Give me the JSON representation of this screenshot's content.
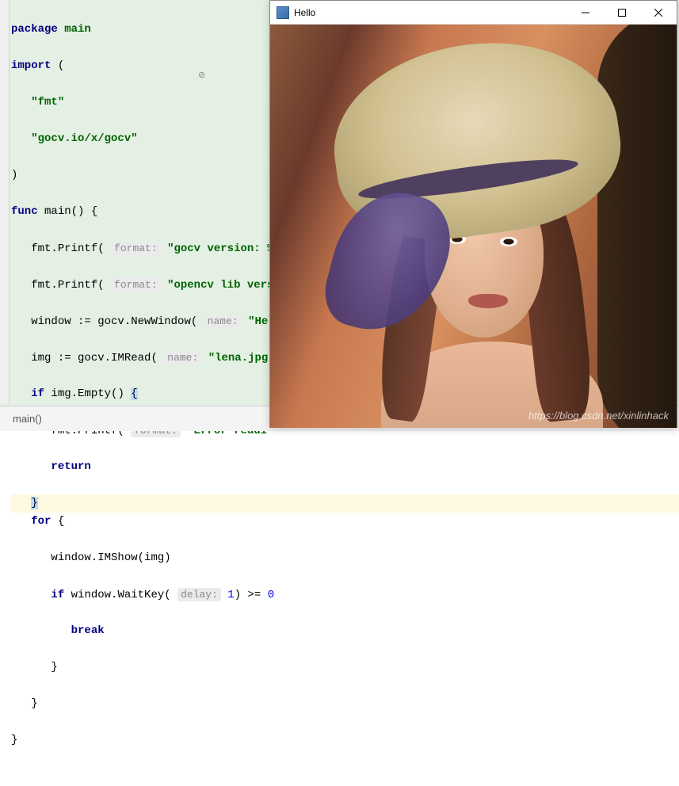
{
  "editor": {
    "lines": {
      "l1_package": "package",
      "l1_main": "main",
      "l2_import": "import",
      "l2_paren": " (",
      "l3_fmt": "\"fmt\"",
      "l4_gocv": "\"gocv.io/x/gocv\"",
      "l5_paren": ")",
      "l6_func": "func",
      "l6_main": " main() {",
      "l7_call": "fmt.Printf(",
      "l7_hint": "format:",
      "l7_str": "\"gocv version: %",
      "l8_call": "fmt.Printf(",
      "l8_hint": "format:",
      "l8_str": "\"opencv lib vers",
      "l9_call": "window := gocv.NewWindow(",
      "l9_hint": "name:",
      "l9_str": "\"Hel",
      "l10_call": "img := gocv.IMRead(",
      "l10_hint": "name:",
      "l10_str": "\"lena.jpg\"",
      "l11_if": "if",
      "l11_cond": " img.Empty() ",
      "l11_brace": "{",
      "l12_call": "fmt.Printf(",
      "l12_hint": "format:",
      "l12_str": "\"Error readi",
      "l13_return": "return",
      "l14_brace": "}",
      "l15_for": "for",
      "l15_brace": " {",
      "l16_call": "window.IMShow(img)",
      "l17_if": "if",
      "l17_call": " window.WaitKey(",
      "l17_hint": "delay:",
      "l17_num": "1",
      "l17_rest": ") >= ",
      "l17_zero": "0",
      "l18_break": "break",
      "l19_brace": "}",
      "l20_brace": "}",
      "l21_brace": "}"
    },
    "breadcrumb": "main()"
  },
  "window": {
    "title": "Hello",
    "watermark": "https://blog.csdn.net/xinlinhack"
  }
}
